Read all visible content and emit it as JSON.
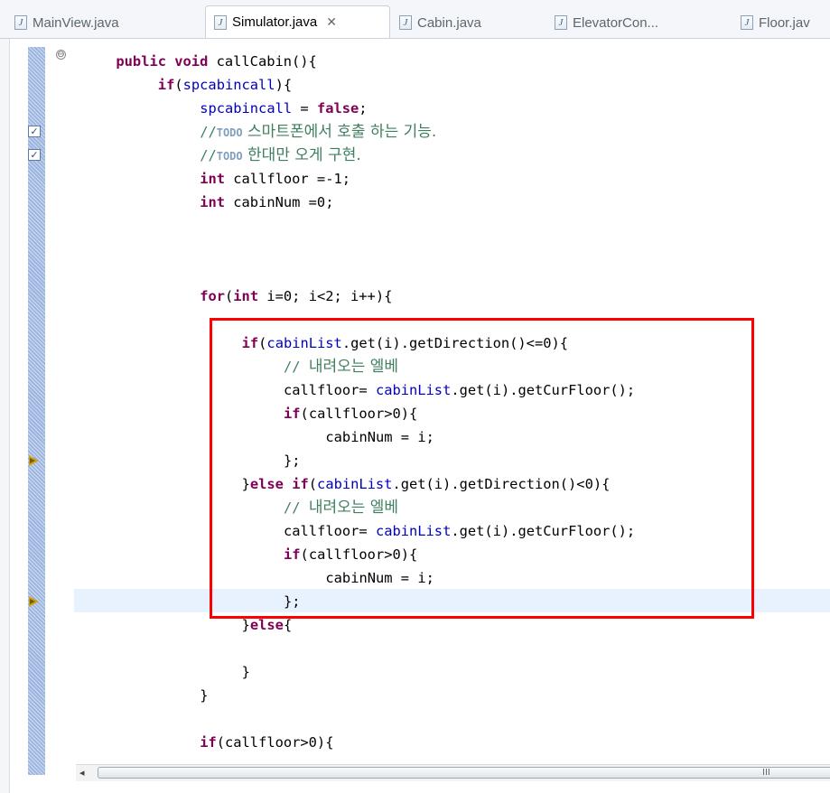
{
  "tabs": [
    {
      "label": "MainView.java"
    },
    {
      "label": "Simulator.java"
    },
    {
      "label": "Cabin.java"
    },
    {
      "label": "ElevatorCon..."
    },
    {
      "label": "Floor.jav"
    }
  ],
  "tab_close_glyph": "✕",
  "file_icon_letter": "J",
  "code_lines": [
    {
      "i": 0,
      "l": 1,
      "t": [
        [
          "kw",
          "public "
        ],
        [
          "kw",
          "void "
        ],
        [
          "",
          "callCabin(){"
        ]
      ]
    },
    {
      "i": 1,
      "l": 2,
      "t": [
        [
          "kw",
          "if"
        ],
        [
          "",
          "("
        ],
        [
          "fld",
          "spcabincall"
        ],
        [
          "",
          ")"
        ],
        [
          "",
          "{"
        ]
      ]
    },
    {
      "i": 2,
      "l": 3,
      "t": [
        [
          "fld",
          "spcabincall"
        ],
        [
          "",
          " = "
        ],
        [
          "kw",
          "false"
        ],
        [
          "",
          ";"
        ]
      ]
    },
    {
      "i": 3,
      "l": 3,
      "t": [
        [
          "cm",
          "//"
        ],
        [
          "todo",
          "TODO"
        ],
        [
          "cm kor",
          " 스마트폰에서 호출 하는 기능."
        ]
      ]
    },
    {
      "i": 4,
      "l": 3,
      "t": [
        [
          "cm",
          "//"
        ],
        [
          "todo",
          "TODO"
        ],
        [
          "cm kor",
          " 한대만 오게 구현."
        ]
      ]
    },
    {
      "i": 5,
      "l": 3,
      "t": [
        [
          "kw",
          "int "
        ],
        [
          "",
          "callfloor =-1;"
        ]
      ]
    },
    {
      "i": 6,
      "l": 3,
      "t": [
        [
          "kw",
          "int "
        ],
        [
          "",
          "cabinNum =0;"
        ]
      ]
    },
    {
      "i": 10,
      "l": 3,
      "t": [
        [
          "kw",
          "for"
        ],
        [
          "",
          "("
        ],
        [
          "kw",
          "int "
        ],
        [
          "",
          "i=0; i<2; i++){"
        ]
      ]
    },
    {
      "i": 12,
      "l": 4,
      "t": [
        [
          "kw",
          "if"
        ],
        [
          "",
          "("
        ],
        [
          "fld",
          "cabinList"
        ],
        [
          "",
          ".get(i).getDirection()<=0){"
        ]
      ]
    },
    {
      "i": 13,
      "l": 5,
      "t": [
        [
          "cm",
          "// "
        ],
        [
          "cm kor",
          "내려오는 엘베"
        ]
      ]
    },
    {
      "i": 14,
      "l": 5,
      "t": [
        [
          "",
          "callfloor= "
        ],
        [
          "fld",
          "cabinList"
        ],
        [
          "",
          ".get(i).getCurFloor();"
        ]
      ]
    },
    {
      "i": 15,
      "l": 5,
      "t": [
        [
          "kw",
          "if"
        ],
        [
          "",
          "(callfloor>0){"
        ]
      ]
    },
    {
      "i": 16,
      "l": 6,
      "t": [
        [
          "",
          "cabinNum = i;"
        ]
      ]
    },
    {
      "i": 17,
      "l": 5,
      "t": [
        [
          "",
          "};"
        ]
      ]
    },
    {
      "i": 18,
      "l": 4,
      "t": [
        [
          "",
          "}"
        ],
        [
          "kw",
          "else "
        ],
        [
          "kw",
          "if"
        ],
        [
          "",
          "("
        ],
        [
          "fld",
          "cabinList"
        ],
        [
          "",
          ".get(i).getDirection()<0){"
        ]
      ]
    },
    {
      "i": 19,
      "l": 5,
      "t": [
        [
          "cm",
          "// "
        ],
        [
          "cm kor",
          "내려오는 엘베"
        ]
      ]
    },
    {
      "i": 20,
      "l": 5,
      "t": [
        [
          "",
          "callfloor= "
        ],
        [
          "fld",
          "cabinList"
        ],
        [
          "",
          ".get(i).getCurFloor();"
        ]
      ]
    },
    {
      "i": 21,
      "l": 5,
      "t": [
        [
          "kw",
          "if"
        ],
        [
          "",
          "(callfloor>0){"
        ]
      ]
    },
    {
      "i": 22,
      "l": 6,
      "t": [
        [
          "",
          "cabinNum = i;"
        ]
      ]
    },
    {
      "i": 23,
      "l": 5,
      "t": [
        [
          "",
          "};"
        ]
      ]
    },
    {
      "i": 24,
      "l": 4,
      "t": [
        [
          "",
          "}"
        ],
        [
          "kw",
          "else"
        ],
        [
          "",
          "{"
        ]
      ]
    },
    {
      "i": 26,
      "l": 4,
      "t": [
        [
          "",
          "}"
        ]
      ]
    },
    {
      "i": 27,
      "l": 3,
      "t": [
        [
          "",
          "}"
        ]
      ]
    },
    {
      "i": 29,
      "l": 3,
      "t": [
        [
          "kw",
          "if"
        ],
        [
          "",
          "(callfloor>0){"
        ]
      ]
    }
  ],
  "gutter": {
    "fold_glyph": "⊖",
    "task_glyph": "✓",
    "task_lines": [
      3,
      4
    ],
    "debug_arrow_lines": [
      17,
      23
    ],
    "current_line": 23
  },
  "scrollbar": {
    "left_arrow": "◂",
    "grip": "III"
  }
}
